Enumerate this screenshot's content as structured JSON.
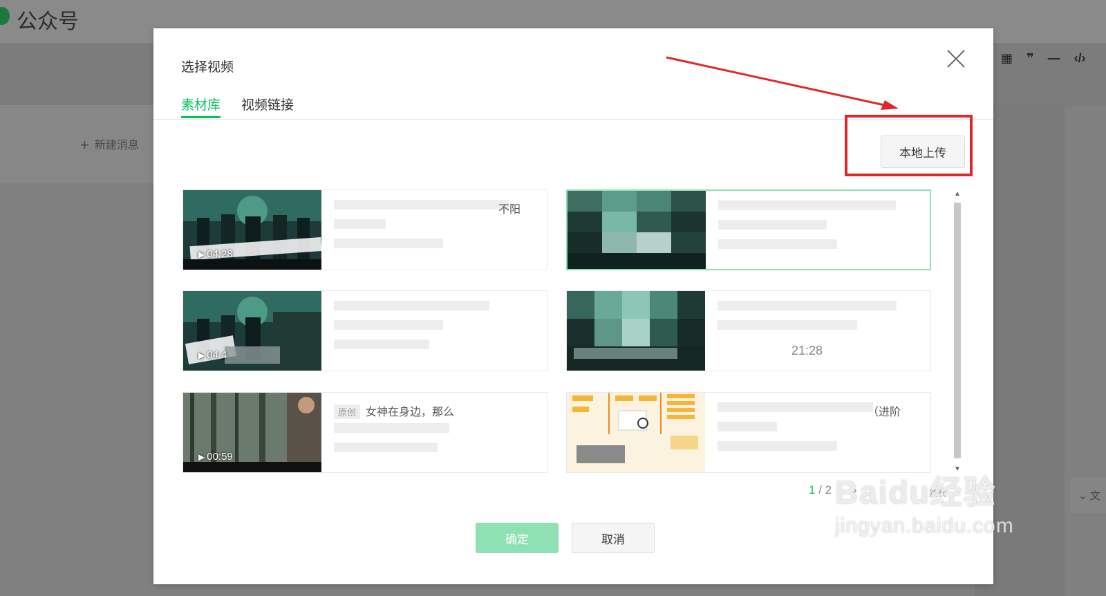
{
  "app": {
    "brand": "公众号",
    "new_message": "新建消息"
  },
  "modal": {
    "title": "选择视频",
    "tabs": [
      {
        "label": "素材库",
        "active": true
      },
      {
        "label": "视频链接",
        "active": false
      }
    ],
    "upload_label": "本地上传",
    "confirm_label": "确定",
    "cancel_label": "取消",
    "accent_color": "#07c160",
    "highlight_color": "#e0282a"
  },
  "videos": [
    {
      "duration": "04:28",
      "snippet": "不阳",
      "selected": false
    },
    {
      "duration": "",
      "snippet": "",
      "selected": true
    },
    {
      "duration": "04:4",
      "snippet": "",
      "selected": false
    },
    {
      "duration": "",
      "snippet": "",
      "right_duration": "21:28",
      "selected": false
    },
    {
      "duration": "00:59",
      "tag": "原创",
      "snippet": "女神在身边，那么",
      "selected": false
    },
    {
      "duration": "",
      "snippet": "（进阶",
      "selected": false
    }
  ],
  "pagination": {
    "current": "1",
    "total": "/ 2",
    "next": "›",
    "jump": "跳转"
  },
  "watermark": {
    "main": "Baidu经验",
    "sub": "jingyan.baidu.com"
  },
  "toolbar_icons": [
    "table-icon",
    "quote-icon",
    "divider-icon",
    "code-icon"
  ],
  "side_panel": {
    "label": "文"
  }
}
